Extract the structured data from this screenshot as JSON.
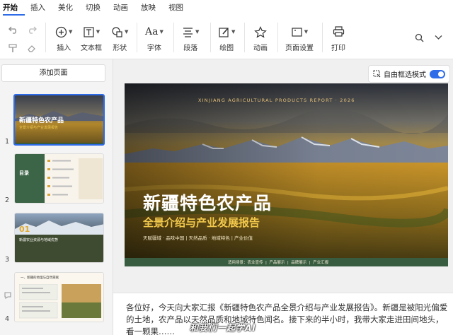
{
  "menu": {
    "items": [
      {
        "label": "开始",
        "active": true
      },
      {
        "label": "插入"
      },
      {
        "label": "美化"
      },
      {
        "label": "切换"
      },
      {
        "label": "动画"
      },
      {
        "label": "放映"
      },
      {
        "label": "视图"
      }
    ]
  },
  "toolbar": {
    "insert": "插入",
    "textbox": "文本框",
    "shape": "形状",
    "font": "字体",
    "paragraph": "段落",
    "drawing": "绘图",
    "animation": "动画",
    "page_setup": "页面设置",
    "print": "打印",
    "font_icon_text": "Aa"
  },
  "sidebar": {
    "add_page": "添加页面",
    "pages": [
      {
        "number": "1",
        "selected": true
      },
      {
        "number": "2"
      },
      {
        "number": "3"
      },
      {
        "number": "4"
      }
    ],
    "thumb1": {
      "title": "新疆特色农产品",
      "subtitle": "全景介绍与产业发展报告"
    },
    "thumb2": {
      "title": "目录"
    },
    "thumb3": {
      "number": "01",
      "title": "新疆农业资源与地域优势"
    },
    "thumb4": {
      "title": "一、新疆的地理与自然禀赋"
    }
  },
  "free_select": {
    "label": "自由框选模式",
    "enabled": true
  },
  "slide": {
    "kicker": "XINJIANG AGRICULTURAL PRODUCTS REPORT · 2026",
    "title": "新疆特色农产品",
    "subtitle": "全景介绍与产业发展报告",
    "tags": "天赋疆域 · 品味中国  |  天然品质 · 地域特色  |  产业价值",
    "footer_items": [
      "适用场景：农业宣传",
      "产品展示",
      "品牌展示",
      "产业汇报"
    ],
    "colors": {
      "title": "#ffffff",
      "subtitle": "#f2c94c",
      "band": "#385c3f"
    }
  },
  "notes": {
    "text": "各位好，今天向大家汇报《新疆特色农产品全景介绍与产业发展报告》。新疆是被阳光偏爱的土地，农产品以天然品质和地域特色闻名。接下来的半小时，我带大家走进田间地头，看一颗果……"
  },
  "watermark": "和我们一起学AI"
}
